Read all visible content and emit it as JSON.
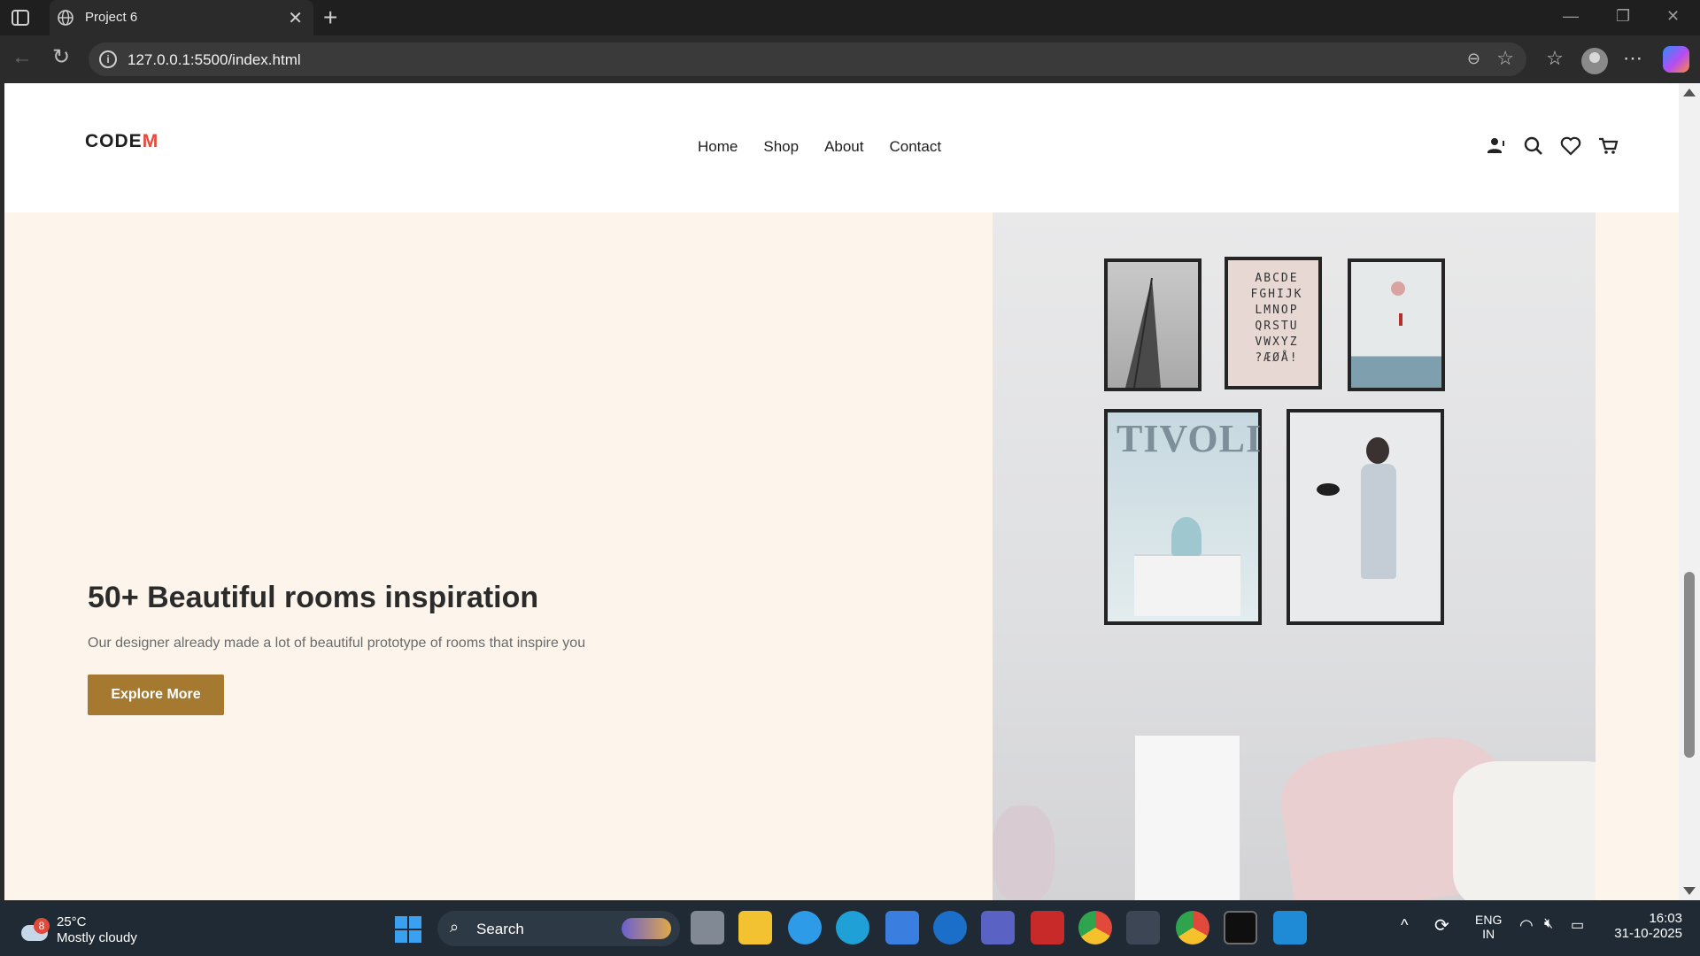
{
  "browser": {
    "tab_title": "Project 6",
    "url": "127.0.0.1:5500/index.html"
  },
  "site": {
    "logo_text": "CODE",
    "logo_mark": "M",
    "nav": [
      "Home",
      "Shop",
      "About",
      "Contact"
    ],
    "header_icons": [
      "account-icon",
      "search-icon",
      "heart-icon",
      "cart-icon"
    ],
    "hero": {
      "title": "50+ Beautiful rooms inspiration",
      "subtitle": "Our designer already made a lot of beautiful prototype of rooms that inspire you",
      "button": "Explore More",
      "button_color": "#a57a30",
      "background": "#fdf5ec"
    },
    "poster_letters": [
      "ABCDE",
      "FGHIJK",
      "LMNOP",
      "QRSTU",
      "VWXYZ",
      "?ÆØÅ!"
    ],
    "poster_tivoli": "TIVOLI"
  },
  "taskbar": {
    "weather_badge": "8",
    "temperature": "25°C",
    "weather": "Mostly cloudy",
    "search_placeholder": "Search",
    "lang_1": "ENG",
    "lang_2": "IN",
    "time": "16:03",
    "date": "31-10-2025"
  }
}
